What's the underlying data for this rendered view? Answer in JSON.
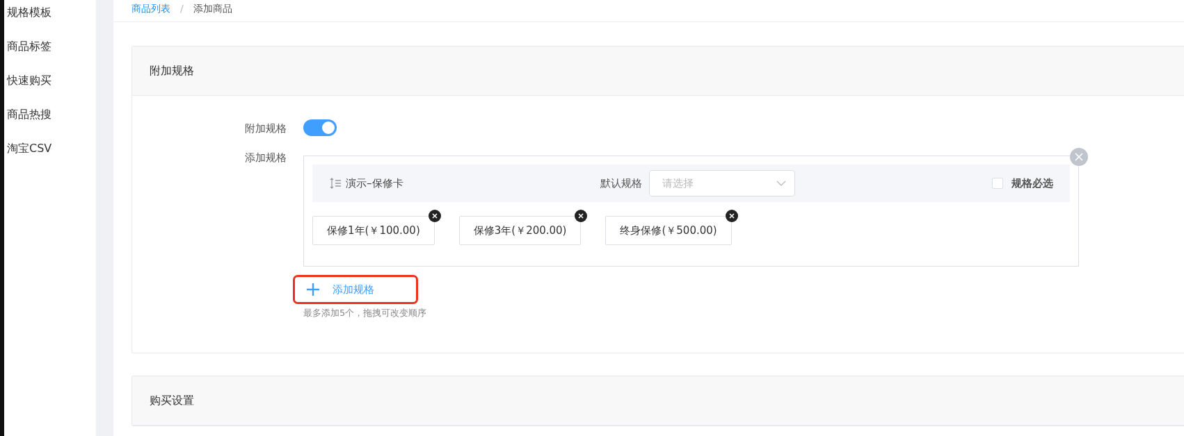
{
  "sidebar": {
    "items": [
      {
        "label": "规格模板",
        "selected": false
      },
      {
        "label": "商品标签",
        "selected": false
      },
      {
        "label": "快速购买",
        "selected": false
      },
      {
        "label": "商品热搜",
        "selected": false
      },
      {
        "label": "淘宝CSV",
        "selected": false
      }
    ]
  },
  "breadcrumb": {
    "items": [
      "商品列表",
      "添加商品"
    ],
    "separator": "/"
  },
  "extra_spec_card": {
    "title": "附加规格",
    "toggle": {
      "label": "附加规格",
      "on": true
    },
    "spec_label": "添加规格",
    "specs": [
      {
        "name": "演示–保修卡",
        "default_label": "默认规格",
        "default_placeholder": "请选择",
        "required_label": "规格必选",
        "required_checked": false,
        "options": [
          "保修1年(￥100.00)",
          "保修3年(￥200.00)",
          "终身保修(￥500.00)"
        ]
      }
    ],
    "add_button": "添加规格",
    "hint": "最多添加5个，拖拽可改变顺序"
  },
  "purchase_card": {
    "title": "购买设置"
  }
}
